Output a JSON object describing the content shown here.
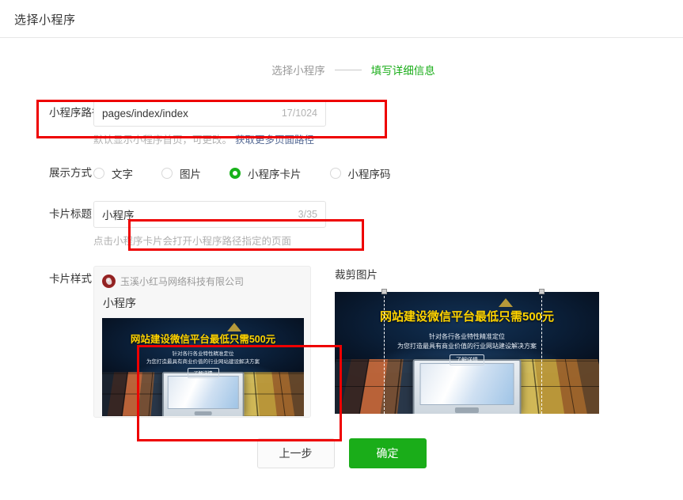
{
  "header": {
    "title": "选择小程序"
  },
  "steps": {
    "step1": "选择小程序",
    "step2": "填写详细信息"
  },
  "path_field": {
    "label": "小程序路径",
    "value": "pages/index/index",
    "placeholder": "pages/index/index",
    "counter": "17/1024",
    "hint": "默认显示小程序首页，可更改。",
    "hint_link": "获取更多页面路径"
  },
  "display_mode": {
    "label": "展示方式",
    "options": [
      {
        "label": "文字",
        "checked": false
      },
      {
        "label": "图片",
        "checked": false
      },
      {
        "label": "小程序卡片",
        "checked": true
      },
      {
        "label": "小程序码",
        "checked": false
      }
    ]
  },
  "card_title_field": {
    "label": "卡片标题",
    "value": "小程序",
    "placeholder": "小程序",
    "counter": "3/35",
    "hint": "点击小程序卡片会打开小程序路径指定的页面"
  },
  "card_style": {
    "label": "卡片样式",
    "org_name": "玉溪小红马网络科技有限公司",
    "card_title": "小程序",
    "logo_icon": "company-logo-icon"
  },
  "banner": {
    "headline": "网站建设微信平台最低只需500元",
    "sub_line1": "针对各行各业特性精准定位",
    "sub_line2": "为您打造最具有商业价值的行业网站建设解决方案",
    "button": "了解详情"
  },
  "crop": {
    "label": "裁剪图片"
  },
  "footer": {
    "prev": "上一步",
    "confirm": "确定"
  },
  "colors": {
    "accent_green": "#1aad19",
    "link_blue": "#576b95",
    "annotation_red": "#ee0000",
    "headline_yellow": "#ffd400"
  }
}
